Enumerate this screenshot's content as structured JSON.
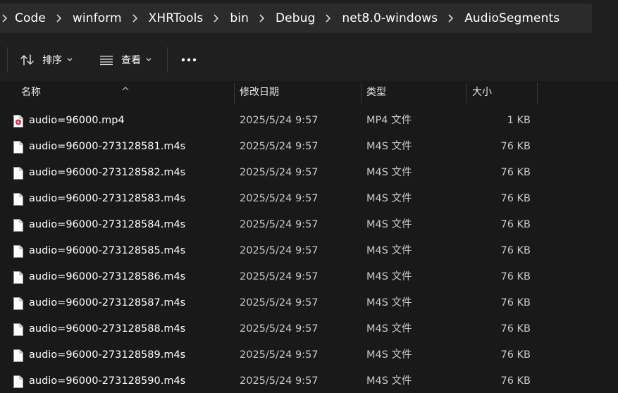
{
  "breadcrumb": {
    "items": [
      "Code",
      "winform",
      "XHRTools",
      "bin",
      "Debug",
      "net8.0-windows",
      "AudioSegments"
    ]
  },
  "toolbar": {
    "sort_label": "排序",
    "view_label": "查看",
    "more_icon": "more-icon"
  },
  "columns": {
    "name": "名称",
    "modified": "修改日期",
    "type": "类型",
    "size": "大小"
  },
  "files": [
    {
      "name": "audio=96000.mp4",
      "modified": "2025/5/24 9:57",
      "type": "MP4 文件",
      "size": "1 KB",
      "icon": "video-file-icon"
    },
    {
      "name": "audio=96000-273128581.m4s",
      "modified": "2025/5/24 9:57",
      "type": "M4S 文件",
      "size": "76 KB",
      "icon": "file-icon"
    },
    {
      "name": "audio=96000-273128582.m4s",
      "modified": "2025/5/24 9:57",
      "type": "M4S 文件",
      "size": "76 KB",
      "icon": "file-icon"
    },
    {
      "name": "audio=96000-273128583.m4s",
      "modified": "2025/5/24 9:57",
      "type": "M4S 文件",
      "size": "76 KB",
      "icon": "file-icon"
    },
    {
      "name": "audio=96000-273128584.m4s",
      "modified": "2025/5/24 9:57",
      "type": "M4S 文件",
      "size": "76 KB",
      "icon": "file-icon"
    },
    {
      "name": "audio=96000-273128585.m4s",
      "modified": "2025/5/24 9:57",
      "type": "M4S 文件",
      "size": "76 KB",
      "icon": "file-icon"
    },
    {
      "name": "audio=96000-273128586.m4s",
      "modified": "2025/5/24 9:57",
      "type": "M4S 文件",
      "size": "76 KB",
      "icon": "file-icon"
    },
    {
      "name": "audio=96000-273128587.m4s",
      "modified": "2025/5/24 9:57",
      "type": "M4S 文件",
      "size": "76 KB",
      "icon": "file-icon"
    },
    {
      "name": "audio=96000-273128588.m4s",
      "modified": "2025/5/24 9:57",
      "type": "M4S 文件",
      "size": "76 KB",
      "icon": "file-icon"
    },
    {
      "name": "audio=96000-273128589.m4s",
      "modified": "2025/5/24 9:57",
      "type": "M4S 文件",
      "size": "76 KB",
      "icon": "file-icon"
    },
    {
      "name": "audio=96000-273128590.m4s",
      "modified": "2025/5/24 9:57",
      "type": "M4S 文件",
      "size": "76 KB",
      "icon": "file-icon"
    }
  ],
  "colors": {
    "background": "#191919",
    "toolbar": "#1f1f1f",
    "breadcrumb_bg": "#2b2b2b",
    "video_icon_accent": "#c4314b"
  }
}
